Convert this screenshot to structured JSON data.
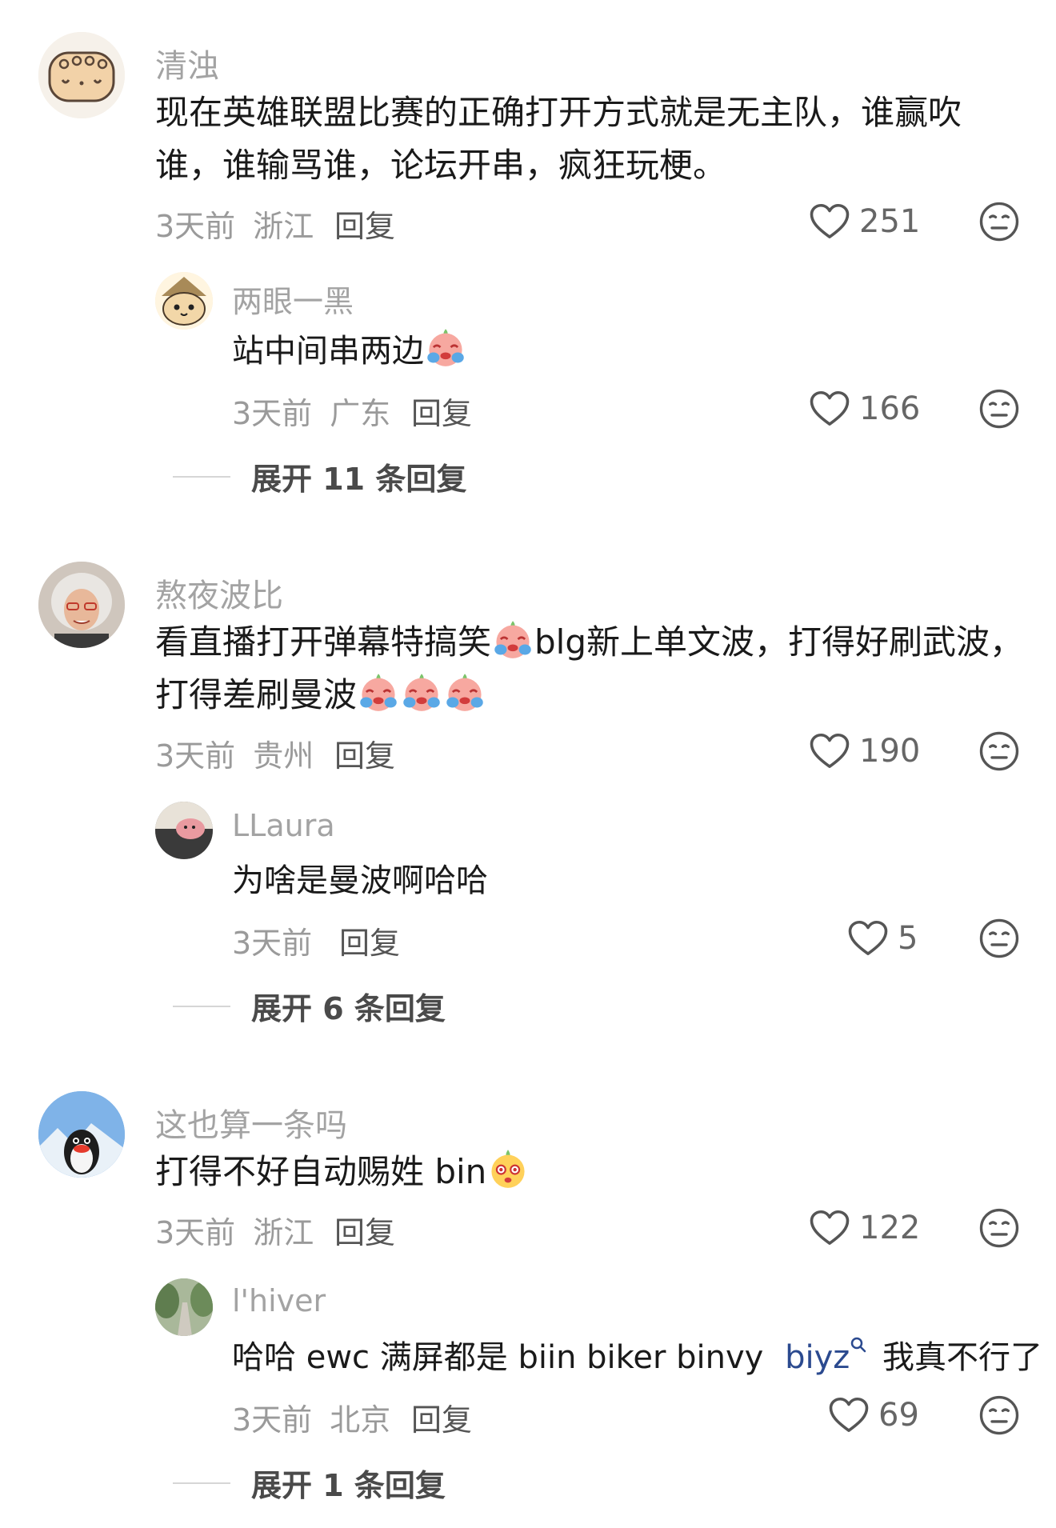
{
  "comments": [
    {
      "username": "清浊",
      "text_line1": "现在英雄联盟比赛的正确打开方式就是无主队，谁赢吹",
      "text_line2": "谁，谁输骂谁，论坛开串，疯狂玩梗。",
      "time": "3天前",
      "location": "浙江",
      "reply_label": "回复",
      "likes": "251",
      "replies": [
        {
          "username": "两眼一黑",
          "text": "站中间串两边",
          "emoji": "crying-emoji",
          "time": "3天前",
          "location": "广东",
          "reply_label": "回复",
          "likes": "166"
        }
      ],
      "expand_label": "展开 11 条回复"
    },
    {
      "username": "熬夜波比",
      "text_line1_a": "看直播打开弹幕特搞笑",
      "text_line1_b": "blg新上单文波，打得好刷武波，",
      "text_line2": "打得差刷曼波",
      "emoji": "crying-emoji",
      "time": "3天前",
      "location": "贵州",
      "reply_label": "回复",
      "likes": "190",
      "replies": [
        {
          "username": "LLaura",
          "text": "为啥是曼波啊哈哈",
          "time": "3天前",
          "reply_label": "回复",
          "likes": "5"
        }
      ],
      "expand_label": "展开 6 条回复"
    },
    {
      "username": "这也算一条吗",
      "text": "打得不好自动赐姓 bin",
      "emoji": "dizzy-emoji",
      "time": "3天前",
      "location": "浙江",
      "reply_label": "回复",
      "likes": "122",
      "replies": [
        {
          "username": "l'hiver",
          "text_a": "哈哈 ewc 满屏都是 biin biker binvy",
          "search_term": "biyz",
          "text_b": "我真不行了",
          "time": "3天前",
          "location": "北京",
          "reply_label": "回复",
          "likes": "69"
        }
      ],
      "expand_label": "展开 1 条回复"
    }
  ],
  "icons": {
    "like": "heart-outline-icon",
    "dislike": "meh-face-icon",
    "search": "search-icon"
  },
  "colors": {
    "username": "#a3a3a3",
    "link": "#2b4a8f"
  }
}
